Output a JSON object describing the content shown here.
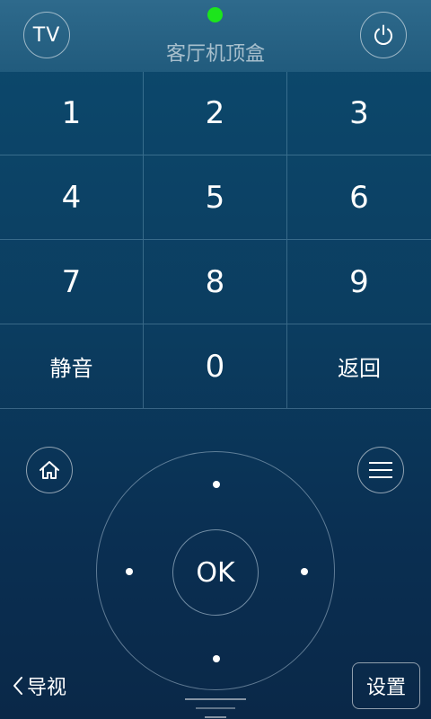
{
  "header": {
    "tv_label": "TV",
    "device_name": "客厅机顶盒",
    "status_color": "#1ce51c"
  },
  "keypad": {
    "keys": [
      "1",
      "2",
      "3",
      "4",
      "5",
      "6",
      "7",
      "8",
      "9",
      "静音",
      "0",
      "返回"
    ]
  },
  "dpad": {
    "ok_label": "OK"
  },
  "icons": {
    "power": "power-icon",
    "home": "home-icon",
    "menu": "menu-icon",
    "back": "chevron-left-icon"
  },
  "bottom": {
    "nav_label": "导视",
    "settings_label": "设置"
  }
}
